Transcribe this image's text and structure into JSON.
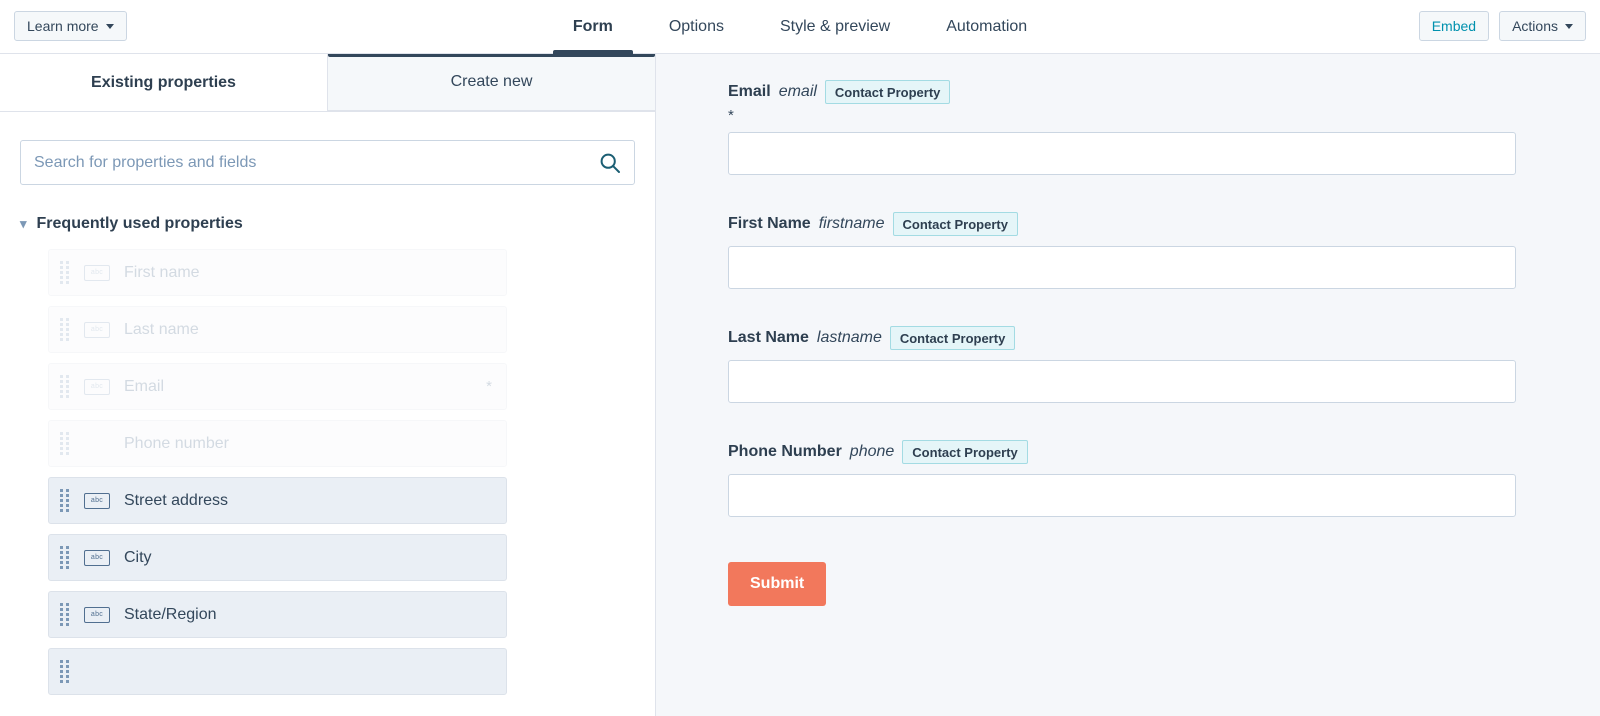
{
  "topbar": {
    "learn_more_label": "Learn more",
    "tabs": [
      {
        "label": "Form",
        "active": true
      },
      {
        "label": "Options",
        "active": false
      },
      {
        "label": "Style & preview",
        "active": false
      },
      {
        "label": "Automation",
        "active": false
      }
    ],
    "embed_label": "Embed",
    "actions_label": "Actions"
  },
  "left_panel": {
    "tabs": [
      {
        "label": "Existing properties",
        "active": true
      },
      {
        "label": "Create new",
        "active": false
      }
    ],
    "search": {
      "placeholder": "Search for properties and fields",
      "value": "",
      "icon": "search-icon"
    },
    "group": {
      "title": "Frequently used properties",
      "expanded": true,
      "chevron_icon": "chevron-down-icon"
    },
    "properties": [
      {
        "label": "First name",
        "icon": "abc-text-field-icon",
        "disabled": true,
        "required": false,
        "show_icon": true
      },
      {
        "label": "Last name",
        "icon": "abc-text-field-icon",
        "disabled": true,
        "required": false,
        "show_icon": true
      },
      {
        "label": "Email",
        "icon": "abc-text-field-icon",
        "disabled": true,
        "required": true,
        "show_icon": true,
        "required_marker": "*"
      },
      {
        "label": "Phone number",
        "icon": "abc-text-field-icon",
        "disabled": true,
        "required": false,
        "show_icon": false
      },
      {
        "label": "Street address",
        "icon": "abc-text-field-icon",
        "disabled": false,
        "required": false,
        "show_icon": true
      },
      {
        "label": "City",
        "icon": "abc-text-field-icon",
        "disabled": false,
        "required": false,
        "show_icon": true
      },
      {
        "label": "State/Region",
        "icon": "abc-text-field-icon",
        "disabled": false,
        "required": false,
        "show_icon": true
      },
      {
        "label": "",
        "icon": "abc-text-field-icon",
        "disabled": false,
        "required": false,
        "show_icon": false
      }
    ],
    "icon_glyph": "abc"
  },
  "right_panel": {
    "fields": [
      {
        "label": "Email",
        "internal_name": "email",
        "badge": "Contact Property",
        "required_marker": "*",
        "value": ""
      },
      {
        "label": "First Name",
        "internal_name": "firstname",
        "badge": "Contact Property",
        "required_marker": "",
        "value": ""
      },
      {
        "label": "Last Name",
        "internal_name": "lastname",
        "badge": "Contact Property",
        "required_marker": "",
        "value": ""
      },
      {
        "label": "Phone Number",
        "internal_name": "phone",
        "badge": "Contact Property",
        "required_marker": "",
        "value": ""
      }
    ],
    "submit_label": "Submit"
  },
  "colors": {
    "accent_navy": "#33475b",
    "badge_bg": "#e5f5f8",
    "badge_border": "#a3dbe3",
    "submit_orange": "#f2785c",
    "panel_bg": "#f5f7fa",
    "link_teal": "#0091ae"
  }
}
